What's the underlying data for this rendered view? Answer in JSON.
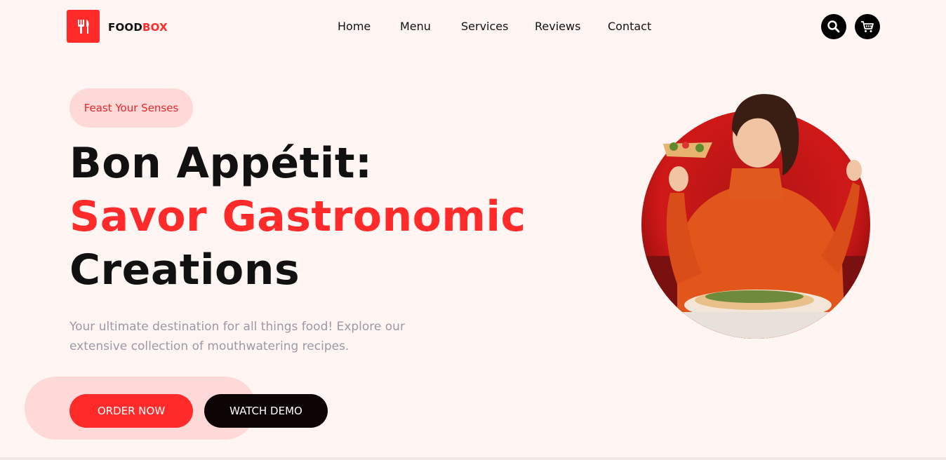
{
  "brand": {
    "name_part1": "FOOD",
    "name_part2": "BOX",
    "logo_icon": "utensils-icon",
    "accent_color": "#ff2a2a"
  },
  "nav": {
    "items": [
      {
        "label": "Home"
      },
      {
        "label": "Menu"
      },
      {
        "label": "Services"
      },
      {
        "label": "Reviews"
      },
      {
        "label": "Contact"
      }
    ]
  },
  "header_actions": {
    "search_icon": "search-icon",
    "cart_icon": "cart-icon"
  },
  "hero": {
    "badge": "Feast Your Senses",
    "title_line1": "Bon Appétit:",
    "title_line2": "Savor Gastronomic",
    "title_line3": "Creations",
    "description": "Your ultimate destination for all things food! Explore our extensive collection of mouthwatering recipes.",
    "order_button": "ORDER NOW",
    "demo_button": "WATCH DEMO"
  }
}
